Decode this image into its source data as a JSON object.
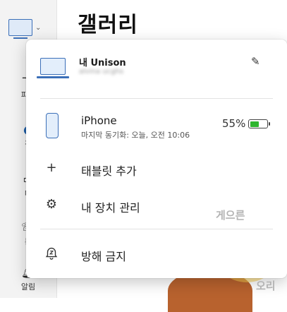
{
  "background": {
    "title": "갤러리",
    "sidebar": [
      {
        "label": "파일",
        "icon": "folder-icon"
      },
      {
        "label": "갤",
        "icon": "gallery-icon"
      },
      {
        "label": "메",
        "icon": "message-icon"
      },
      {
        "label": "통",
        "icon": "call-icon"
      },
      {
        "label": "알림",
        "icon": "bell-icon"
      }
    ]
  },
  "flyout": {
    "pc": {
      "name": "내 Unison",
      "subtitle": "alvina ucghs",
      "icon": "laptop-icon"
    },
    "phone": {
      "name": "iPhone",
      "last_sync": "마지막 동기화: 오늘, 오전 10:06",
      "battery_percent": "55%",
      "battery_level": 0.55,
      "icon": "phone-icon"
    },
    "menu": [
      {
        "label": "태블릿 추가",
        "icon": "plus-icon"
      },
      {
        "label": "내 장치 관리",
        "icon": "gear-icon"
      },
      {
        "label": "방해 금지",
        "icon": "snooze-icon"
      }
    ]
  },
  "watermark": {
    "top": "게으른",
    "bottom": "오리"
  },
  "colors": {
    "accent": "#3b6fb8",
    "battery": "#2fb52f"
  }
}
